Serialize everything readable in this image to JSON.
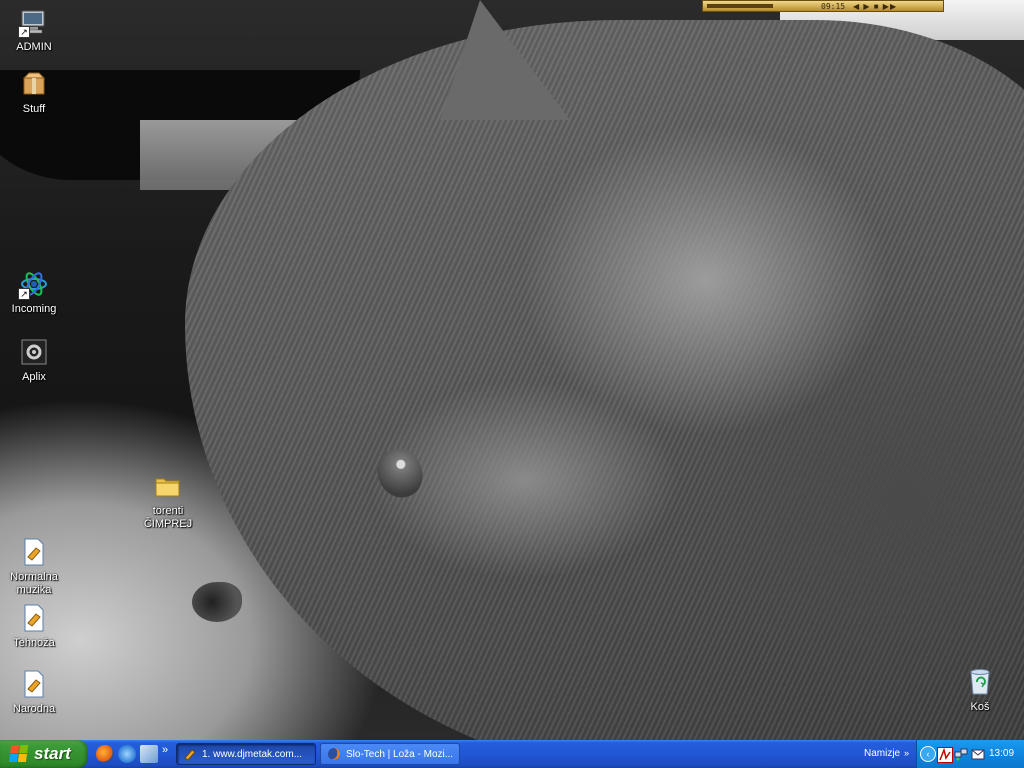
{
  "desktop": {
    "icons": [
      {
        "label": "ADMIN",
        "icon": "computer-icon"
      },
      {
        "label": "Stuff",
        "icon": "box-icon"
      },
      {
        "label": "Incoming",
        "icon": "atom-icon"
      },
      {
        "label": "Aplix",
        "icon": "application-icon"
      },
      {
        "label": "torenti\nČIMPREJ",
        "icon": "folder-icon"
      },
      {
        "label": "Normalna\nmuzika",
        "icon": "playlist-file-icon"
      },
      {
        "label": "Tehnoža",
        "icon": "playlist-file-icon"
      },
      {
        "label": "Narodna",
        "icon": "playlist-file-icon"
      },
      {
        "label": "Koš",
        "icon": "recycle-bin-icon"
      }
    ]
  },
  "player": {
    "time": "09:15",
    "controls": "◀ ▶ ■ ▶▶",
    "progress": 0.28
  },
  "taskbar": {
    "start_label": "start",
    "quick_launch": [
      "firefox-icon",
      "ie-icon",
      "network-icon"
    ],
    "more": "»",
    "tasks": [
      {
        "label": "1. www.djmetak.com...",
        "icon": "winamp-icon",
        "active": true
      },
      {
        "label": "Slo-Tech | Loža - Mozi...",
        "icon": "firefox-icon",
        "active": false
      }
    ],
    "desktop_toolbar": "Namizje",
    "desktop_toolbar_arrow": "»",
    "tray_icons": [
      "hide-tray-icon",
      "pdf-icon",
      "network-icon",
      "mail-icon"
    ],
    "clock": "13:09"
  },
  "colors": {
    "taskbar": "#245edb",
    "start": "#3c9a37",
    "tray": "#0f86e0"
  }
}
